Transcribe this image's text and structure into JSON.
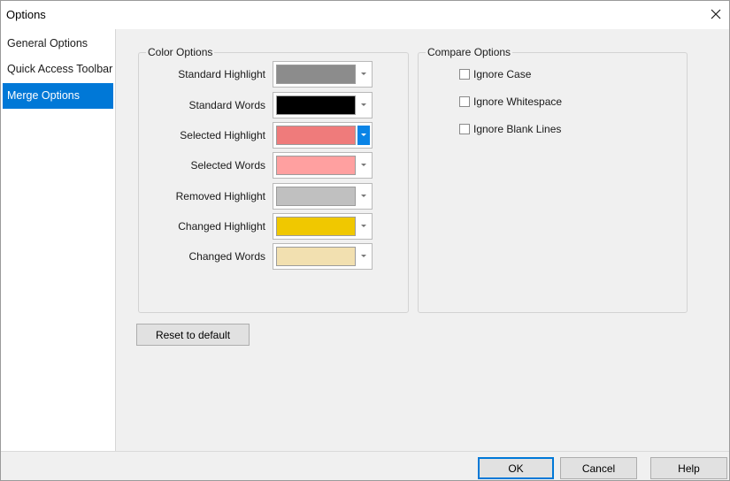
{
  "window": {
    "title": "Options"
  },
  "sidebar": {
    "items": [
      {
        "label": "General Options",
        "selected": false
      },
      {
        "label": "Quick Access Toolbar",
        "selected": false
      },
      {
        "label": "Merge Options",
        "selected": true
      }
    ]
  },
  "color_options": {
    "legend": "Color Options",
    "rows": [
      {
        "label": "Standard Highlight",
        "color": "#8c8c8c",
        "active": false
      },
      {
        "label": "Standard Words",
        "color": "#000000",
        "active": false
      },
      {
        "label": "Selected Highlight",
        "color": "#ef7b7b",
        "active": true
      },
      {
        "label": "Selected Words",
        "color": "#ffa0a0",
        "active": false
      },
      {
        "label": "Removed Highlight",
        "color": "#c0c0c0",
        "active": false
      },
      {
        "label": "Changed Highlight",
        "color": "#f0c800",
        "active": false
      },
      {
        "label": "Changed Words",
        "color": "#f2e0b0",
        "active": false
      }
    ]
  },
  "compare_options": {
    "legend": "Compare Options",
    "items": [
      {
        "label": "Ignore Case",
        "checked": false
      },
      {
        "label": "Ignore Whitespace",
        "checked": false
      },
      {
        "label": "Ignore Blank Lines",
        "checked": false
      }
    ]
  },
  "reset_button": "Reset to default",
  "footer": {
    "ok": "OK",
    "cancel": "Cancel",
    "help": "Help"
  },
  "icons": {
    "close": "close-icon",
    "dropdown": "chevron-down-icon"
  }
}
